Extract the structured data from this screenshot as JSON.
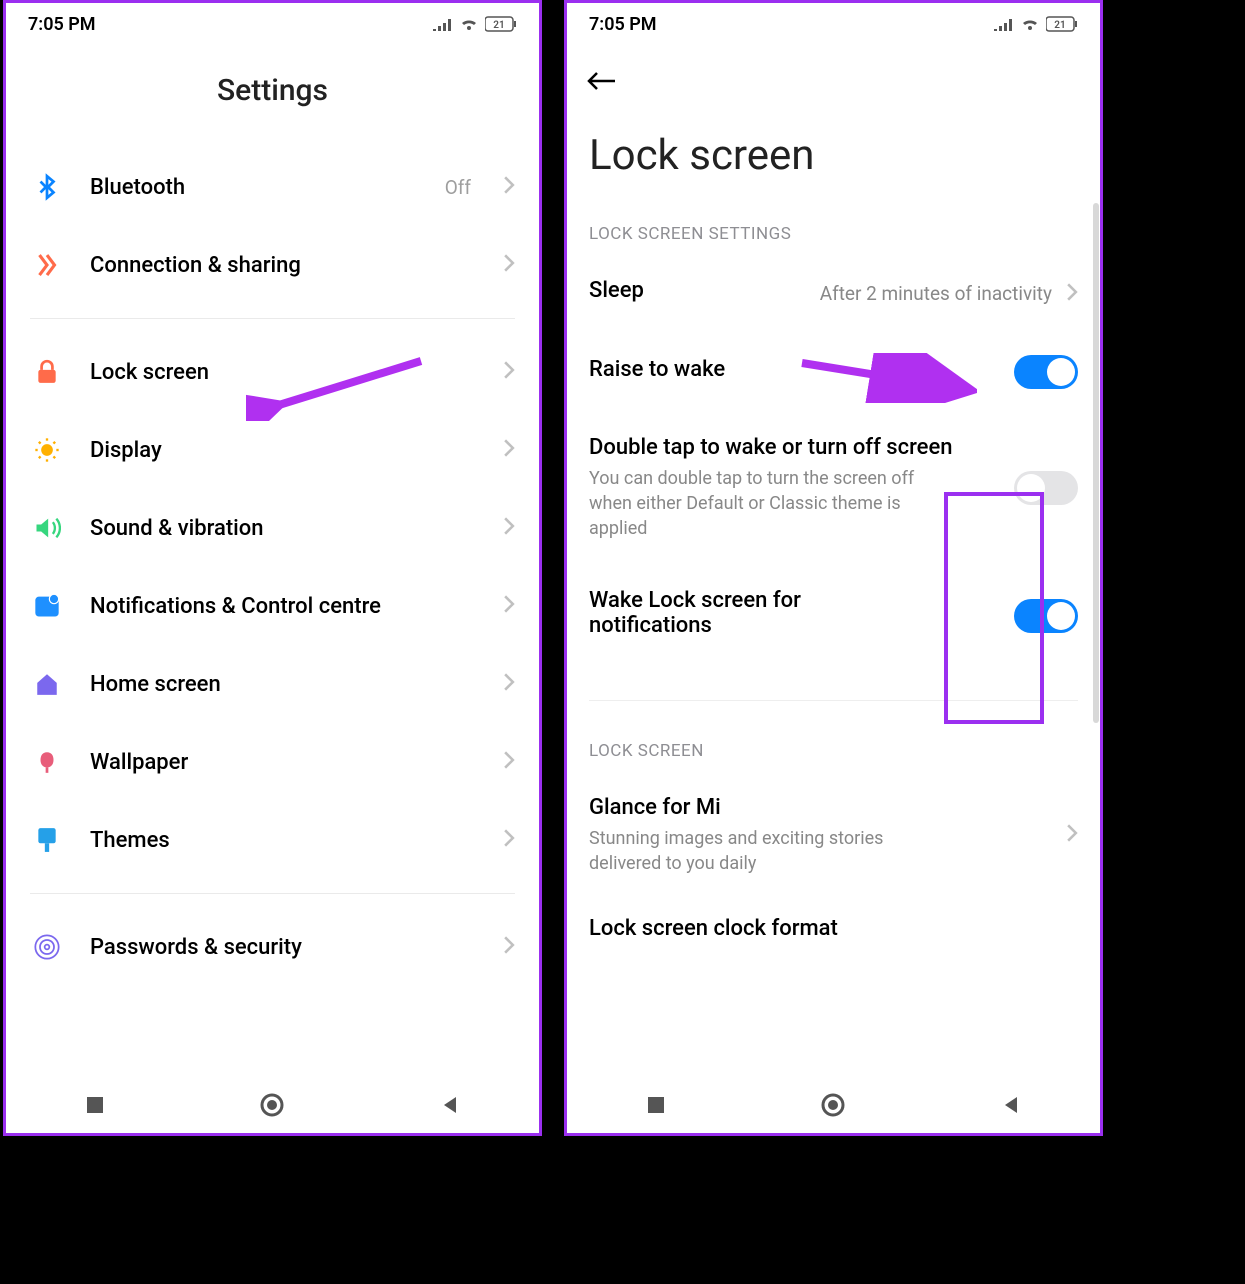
{
  "status": {
    "time": "7:05 PM",
    "battery": "21"
  },
  "left": {
    "title": "Settings",
    "items": [
      {
        "icon": "bluetooth",
        "label": "Bluetooth",
        "value": "Off"
      },
      {
        "icon": "connection",
        "label": "Connection & sharing",
        "value": ""
      },
      {
        "icon": "lock",
        "label": "Lock screen",
        "value": ""
      },
      {
        "icon": "display",
        "label": "Display",
        "value": ""
      },
      {
        "icon": "sound",
        "label": "Sound & vibration",
        "value": ""
      },
      {
        "icon": "notif",
        "label": "Notifications & Control centre",
        "value": ""
      },
      {
        "icon": "home",
        "label": "Home screen",
        "value": ""
      },
      {
        "icon": "wallpaper",
        "label": "Wallpaper",
        "value": ""
      },
      {
        "icon": "themes",
        "label": "Themes",
        "value": ""
      },
      {
        "icon": "security",
        "label": "Passwords & security",
        "value": ""
      }
    ]
  },
  "right": {
    "title": "Lock screen",
    "section1": "LOCK SCREEN SETTINGS",
    "settings": [
      {
        "title": "Sleep",
        "desc": "",
        "value": "After 2 minutes of inactivity",
        "ctrl": "chevron"
      },
      {
        "title": "Raise to wake",
        "desc": "",
        "value": "",
        "ctrl": "toggle-on"
      },
      {
        "title": "Double tap to wake or turn off screen",
        "desc": "You can double tap to turn the screen off when either Default or Classic theme is applied",
        "value": "",
        "ctrl": "toggle-off"
      },
      {
        "title": "Wake Lock screen for notifications",
        "desc": "",
        "value": "",
        "ctrl": "toggle-on"
      }
    ],
    "section2": "LOCK SCREEN",
    "settings2": [
      {
        "title": "Glance for Mi",
        "desc": "Stunning images and exciting stories delivered to you daily",
        "ctrl": "chevron"
      },
      {
        "title": "Lock screen clock format",
        "desc": "",
        "ctrl": "chevron"
      }
    ]
  }
}
